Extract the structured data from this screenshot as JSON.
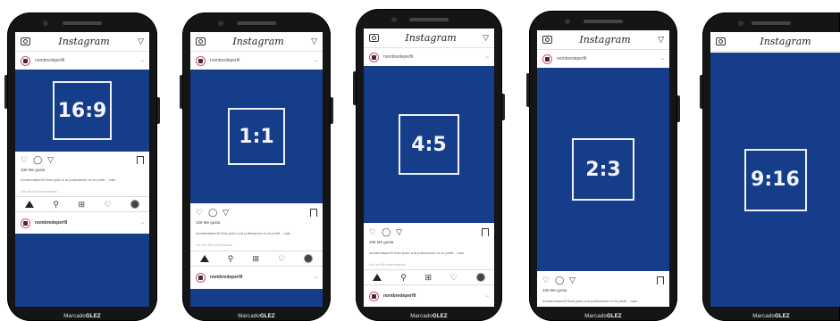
{
  "app": {
    "logo": "Instagram"
  },
  "post": {
    "username": "nombredeperfil",
    "likes": "106 Me gusta",
    "caption": "nombredeperfil  Seto justo a la publicación en tu perfil... más",
    "comments_link": "Ver los 68 comentarios",
    "next_username": "nombredeperfil"
  },
  "device": {
    "brand_prefix": "Marcado",
    "brand_name": "GLEZ"
  },
  "accent": "#163d8a",
  "phones": [
    {
      "ratio": "16:9"
    },
    {
      "ratio": "1:1"
    },
    {
      "ratio": "4:5"
    },
    {
      "ratio": "2:3"
    },
    {
      "ratio": "9:16"
    }
  ]
}
